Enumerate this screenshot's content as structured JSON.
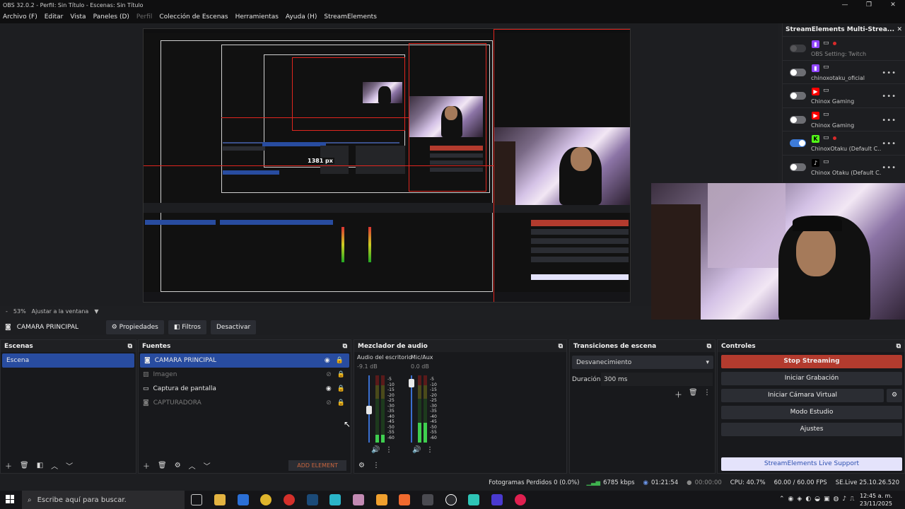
{
  "window": {
    "title": "OBS 32.0.2 - Perfil: Sin Título - Escenas: Sin Título",
    "controls": [
      "—",
      "❐",
      "✕"
    ]
  },
  "menu": {
    "items": [
      "Archivo (F)",
      "Editar",
      "Vista",
      "Paneles (D)",
      "Perfil",
      "Colección de Escenas",
      "Herramientas",
      "Ayuda (H)",
      "StreamElements"
    ]
  },
  "preview": {
    "px_label": "1381 px",
    "zoom_value": "53%",
    "zoom_minus": "-",
    "fit_label": "Ajustar a la ventana"
  },
  "streamelements": {
    "title": "StreamElements Multi-Strea...",
    "colors": {
      "twitch": "#9146ff",
      "youtube": "#ff0000",
      "kick": "#53fc18",
      "tiktok": "#000000"
    },
    "items": [
      {
        "platform": "twitch",
        "name": "OBS Setting: Twitch",
        "state": "disabled",
        "live": true,
        "more": ""
      },
      {
        "platform": "twitch",
        "name": "chinoxotaku_oficial",
        "state": "off",
        "live": false,
        "more": "•••"
      },
      {
        "platform": "youtube",
        "name": "Chinox Gaming",
        "state": "off",
        "live": false,
        "more": "•••"
      },
      {
        "platform": "youtube",
        "name": "Chinox Gaming",
        "state": "off",
        "live": false,
        "more": "•••"
      },
      {
        "platform": "kick",
        "name": "ChinoxOtaku (Default C...",
        "state": "on",
        "live": true,
        "more": "•••"
      },
      {
        "platform": "tiktok",
        "name": "Chinox Otaku (Default C...",
        "state": "off",
        "live": false,
        "more": "•••"
      }
    ]
  },
  "source_bar": {
    "current_source": "CAMARA PRINCIPAL",
    "properties": "Propiedades",
    "filters": "Filtros",
    "deactivate": "Desactivar"
  },
  "scenes": {
    "title": "Escenas",
    "items": [
      "Escena"
    ]
  },
  "sources": {
    "title": "Fuentes",
    "items": [
      {
        "name": "CAMARA PRINCIPAL",
        "selected": true,
        "visible": true
      },
      {
        "name": "Imagen",
        "selected": false,
        "visible": false
      },
      {
        "name": "Captura de pantalla",
        "selected": false,
        "visible": true
      },
      {
        "name": "CAPTURADORA",
        "selected": false,
        "visible": false
      }
    ],
    "add_element": "ADD ELEMENT"
  },
  "mixer": {
    "title": "Mezclador de audio",
    "channels": [
      {
        "name": "Audio del escritorio",
        "db": "-9.1 dB",
        "level": 0.12,
        "fader": 0.55
      },
      {
        "name": "Mic/Aux",
        "db": "0.0 dB",
        "level": 0.3,
        "fader": 0.95
      }
    ],
    "scale": [
      "-5",
      "-10",
      "-15",
      "-20",
      "-25",
      "-30",
      "-35",
      "-40",
      "-45",
      "-50",
      "-55",
      "-60"
    ]
  },
  "transitions": {
    "title": "Transiciones de escena",
    "selected": "Desvanecimiento",
    "duration_label": "Duración",
    "duration_value": "300 ms"
  },
  "controls": {
    "title": "Controles",
    "stop_streaming": "Stop Streaming",
    "start_recording": "Iniciar Grabación",
    "virtual_camera": "Iniciar Cámara Virtual",
    "studio_mode": "Modo Estudio",
    "settings": "Ajustes",
    "support": "StreamElements Live Support",
    "stop_color": "#b33b2e",
    "support_color": "#e4e3fb"
  },
  "status": {
    "dropped": "Fotogramas Perdidos 0 (0.0%)",
    "bitrate": "6785 kbps",
    "stream_time": "01:21:54",
    "rec_time": "00:00:00",
    "cpu": "CPU: 40.7%",
    "fps": "60.00 / 60.00 FPS",
    "version": "SE.Live 25.10.26.520"
  },
  "taskbar": {
    "search_placeholder": "Escribe aquí para buscar.",
    "time": "12:45 a. m.",
    "date": "23/11/2025"
  }
}
